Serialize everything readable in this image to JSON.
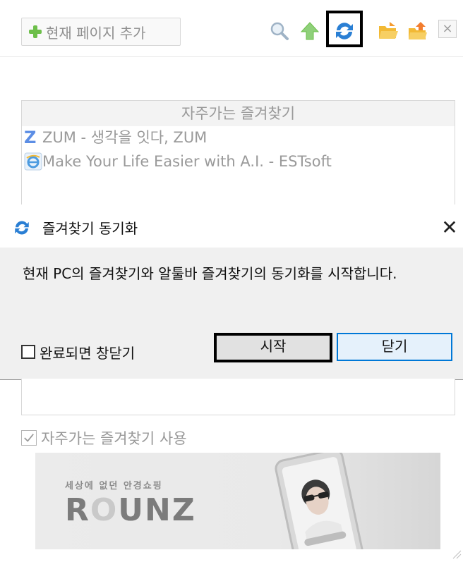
{
  "toolbar": {
    "add_page_label": "현재 페이지 추가",
    "close_glyph": "×"
  },
  "frequent": {
    "header": "자주가는 즐겨찾기",
    "items": [
      {
        "icon": "zum-icon",
        "text": "ZUM - 생각을 잇다, ZUM"
      },
      {
        "icon": "ie-icon",
        "text": "Make Your Life Easier with A.I. - ESTsoft"
      }
    ]
  },
  "dialog": {
    "title": "즐겨찾기 동기화",
    "close_glyph": "✕",
    "message": "현재 PC의 즐겨찾기와 알툴바 즐겨찾기의 동기화를 시작합니다.",
    "checkbox_label": "완료되면 창닫기",
    "checkbox_checked": false,
    "start_label": "시작",
    "close_label": "닫기"
  },
  "use_frequent": {
    "label": "자주가는 즐겨찾기 사용",
    "checked": true
  },
  "ad": {
    "tagline": "세상에 없던 안경쇼핑",
    "brand_pre": "R",
    "brand_o": "O",
    "brand_post": "UNZ"
  },
  "colors": {
    "accent_blue": "#0078d7",
    "sync_blue": "#2a7fd4",
    "green": "#6dbf4a",
    "folder_yellow": "#f2b935"
  }
}
